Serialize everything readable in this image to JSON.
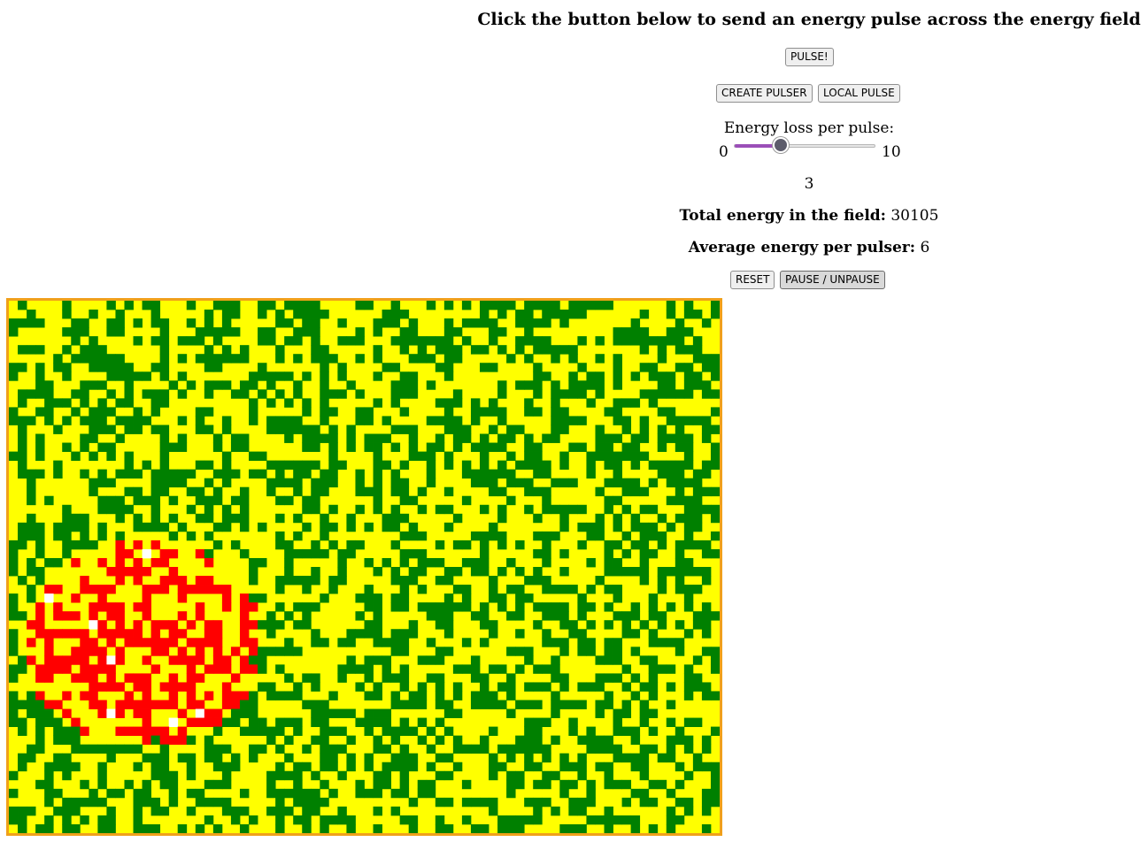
{
  "heading": "Click the button below to send an energy pulse across the energy field",
  "buttons": {
    "pulse": "PULSE!",
    "create_pulser": "CREATE PULSER",
    "local_pulse": "LOCAL PULSE",
    "reset": "RESET",
    "pause": "PAUSE / UNPAUSE"
  },
  "slider": {
    "label": "Energy loss per pulse:",
    "min": "0",
    "max": "10",
    "value": 3,
    "value_text": "3",
    "fill_color": "#9b4fb8"
  },
  "stats": {
    "total_label": "Total energy in the field:",
    "total_value": "30105",
    "avg_label": "Average energy per pulser:",
    "avg_value": "6"
  },
  "field": {
    "columns": 80,
    "rows": 60,
    "colors": {
      "low": "#008000",
      "high": "#ffff00",
      "burst": "#ff0000",
      "empty": "#ffffff",
      "border": "#f0a01a"
    },
    "green_fraction": 0.45,
    "burst_region": {
      "col_from": 1,
      "col_to": 28,
      "row_from": 26,
      "row_to": 50
    }
  }
}
